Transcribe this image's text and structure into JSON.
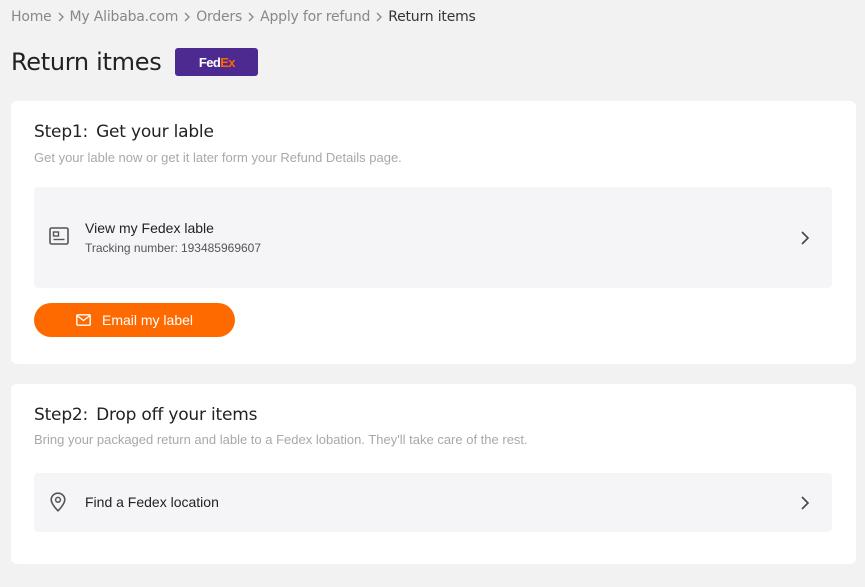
{
  "breadcrumb": {
    "items": [
      "Home",
      "My Alibaba.com",
      "Orders",
      "Apply for refund",
      "Return items"
    ]
  },
  "page": {
    "title": "Return itmes",
    "carrier_logo": {
      "text_fed": "Fed",
      "text_ex": "Ex",
      "bg_color": "#4d2a8f",
      "ex_color": "#ff6600"
    }
  },
  "step1": {
    "number": "Step1:",
    "title": "Get your lable",
    "description": "Get your lable now or get it later form your Refund Details page.",
    "label_row": {
      "icon": "label-icon",
      "title": "View my Fedex lable",
      "tracking_label": "Tracking number:",
      "tracking_number": "193485969607"
    },
    "email_button": {
      "icon": "mail-icon",
      "label": "Email my label",
      "color": "#ff6a00"
    }
  },
  "step2": {
    "number": "Step2:",
    "title": "Drop off your items",
    "description": "Bring your packaged return and lable to a Fedex lobation. They'll take care of the rest.",
    "location_row": {
      "icon": "location-pin-icon",
      "title": "Find a Fedex location"
    }
  }
}
